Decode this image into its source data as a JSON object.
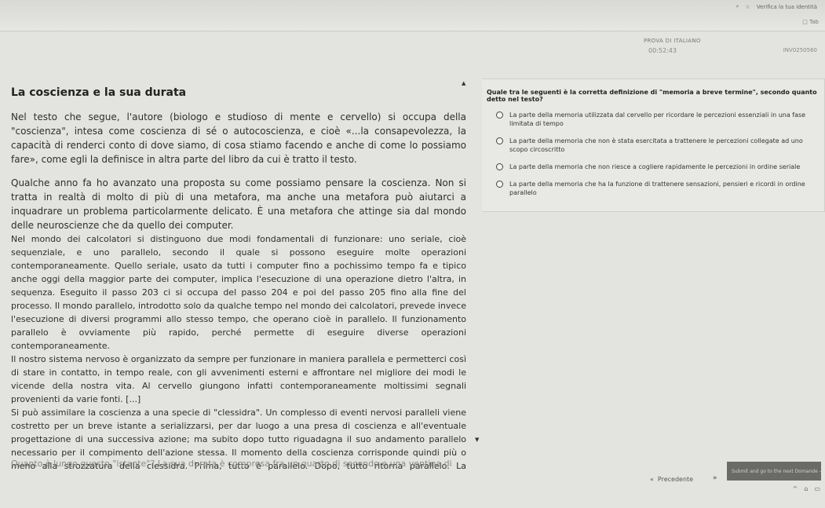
{
  "browser": {
    "bookmark_icon": "star-icon",
    "search_icon": "magnifier-icon",
    "profile_label": "Verifica la tua identità",
    "window_button": "□ Tab"
  },
  "exam": {
    "title": "PROVA DI ITALIANO",
    "timer": "00:52:43",
    "code": "INV0250560"
  },
  "passage": {
    "title": "La coscienza e la sua durata",
    "paragraphs": [
      "Nel testo che segue, l'autore (biologo e studioso di mente e cervello) si occupa della \"coscienza\", intesa come coscienza di sé o autocoscienza, e cioè «...la consapevolezza, la capacità di renderci conto di dove siamo, di cosa stiamo facendo e anche di come lo possiamo fare», come egli la definisce in altra parte del libro da cui è tratto il testo.",
      "Qualche anno fa ho avanzato una proposta su come possiamo pensare la coscienza. Non si tratta in realtà di molto di più di una metafora, ma anche una metafora può aiutarci a inquadrare un problema particolarmente delicato. È una metafora che attinge sia dal mondo delle neuroscienze che da quello dei computer.",
      "Nel mondo dei calcolatori si distinguono due modi fondamentali di funzionare: uno seriale, cioè sequenziale, e uno parallelo, secondo il quale si possono eseguire molte operazioni contemporaneamente. Quello seriale, usato da tutti i computer fino a pochissimo tempo fa e tipico anche oggi della maggior parte dei computer, implica l'esecuzione di una operazione dietro l'altra, in sequenza. Eseguito il passo 203 ci si occupa del passo 204 e poi del passo 205 fino alla fine del processo. Il mondo parallelo, introdotto solo da qualche tempo nel mondo dei calcolatori, prevede invece l'esecuzione di diversi programmi allo stesso tempo, che operano cioè in parallelo. Il funzionamento parallelo è ovviamente più rapido, perché permette di eseguire diverse operazioni contemporaneamente.",
      "Il nostro sistema nervoso è organizzato da sempre per funzionare in maniera parallela e permetterci così di stare in contatto, in tempo reale, con gli avvenimenti esterni e affrontare nel migliore dei modi le vicende della nostra vita. Al cervello giungono infatti contemporaneamente moltissimi segnali provenienti da varie fonti. [...]",
      "Si può assimilare la coscienza a una specie di \"clessidra\". Un complesso di eventi nervosi paralleli viene costretto per un breve istante a serializzarsi, per dar luogo a una presa di coscienza e all'eventuale progettazione di una successiva azione; ma subito dopo tutto riguadagna il suo andamento parallelo necessario per il compimento dell'azione stessa. Il momento della coscienza corrisponde quindi più o meno alla strozzatura della clessidra. Prima, tutto è parallelo. Dopo, tutto ritorna parallelo. La contemplazione cosciente corrisponde al breve istante della serialità."
    ],
    "next_fade": "Quanto è lungo questo \"istante\"? La sua durata è compresa fra un quarto di secondo e una ventina di"
  },
  "question": {
    "text": "Quale tra le seguenti è la corretta definizione di \"memoria a breve termine\", secondo quanto detto nel testo?",
    "options": [
      "La parte della memoria utilizzata dal cervello per ricordare le percezioni essenziali in una fase limitata di tempo",
      "La parte della memoria che non è stata esercitata a trattenere le percezioni collegate ad uno scopo circoscritto",
      "La parte della memoria che non riesce a cogliere rapidamente le percezioni in ordine seriale",
      "La parte della memoria che ha la funzione di trattenere sensazioni, pensieri e ricordi in ordine parallelo"
    ]
  },
  "footer": {
    "prev_label": "Precedente",
    "next_arrows": "»",
    "submit_label": "Submit and go to the next Domande →"
  }
}
